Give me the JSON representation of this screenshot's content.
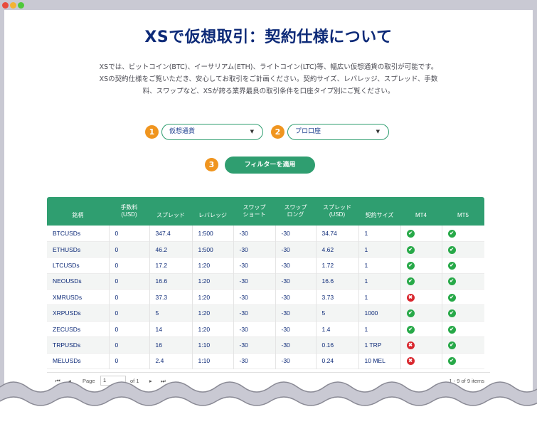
{
  "window": {
    "controls": [
      "close",
      "minimize",
      "maximize"
    ]
  },
  "page": {
    "title": "XSで仮想取引：契約仕様について",
    "intro_lines": [
      "XSでは、ビットコイン(BTC)、イーサリアム(ETH)、ライトコイン(LTC)等、幅広い仮想通貨の取引が可能です。",
      "XSの契約仕様をご覧いただき、安心してお取引をご計画ください。契約サイズ、レバレッジ、スプレッド、手数",
      "料、スワップなど、XSが誇る業界最良の取引条件を口座タイプ別にご覧ください。"
    ]
  },
  "filters": {
    "step1": "1",
    "step2": "2",
    "step3": "3",
    "instrument_select": "仮想通貨",
    "account_select": "プロ口座",
    "apply_label": "フィルターを適用"
  },
  "table": {
    "headers": {
      "symbol": "銘柄",
      "commission": [
        "手数料",
        "(USD)"
      ],
      "spread": "スプレッド",
      "leverage": "レバレッジ",
      "swap_short": [
        "スワップ",
        "ショート"
      ],
      "swap_long": [
        "スワップ",
        "ロング"
      ],
      "spread_usd": [
        "スプレッド",
        "(USD)"
      ],
      "contract_size": "契約サイズ",
      "mt4": "MT4",
      "mt5": "MT5"
    },
    "rows": [
      {
        "symbol": "BTCUSDs",
        "commission": "0",
        "spread": "347.4",
        "leverage": "1:500",
        "swap_short": "-30",
        "swap_long": "-30",
        "spread_usd": "34.74",
        "contract_size": "1",
        "mt4": true,
        "mt5": true
      },
      {
        "symbol": "ETHUSDs",
        "commission": "0",
        "spread": "46.2",
        "leverage": "1:500",
        "swap_short": "-30",
        "swap_long": "-30",
        "spread_usd": "4.62",
        "contract_size": "1",
        "mt4": true,
        "mt5": true
      },
      {
        "symbol": "LTCUSDs",
        "commission": "0",
        "spread": "17.2",
        "leverage": "1:20",
        "swap_short": "-30",
        "swap_long": "-30",
        "spread_usd": "1.72",
        "contract_size": "1",
        "mt4": true,
        "mt5": true
      },
      {
        "symbol": "NEOUSDs",
        "commission": "0",
        "spread": "16.6",
        "leverage": "1:20",
        "swap_short": "-30",
        "swap_long": "-30",
        "spread_usd": "16.6",
        "contract_size": "1",
        "mt4": true,
        "mt5": true
      },
      {
        "symbol": "XMRUSDs",
        "commission": "0",
        "spread": "37.3",
        "leverage": "1:20",
        "swap_short": "-30",
        "swap_long": "-30",
        "spread_usd": "3.73",
        "contract_size": "1",
        "mt4": false,
        "mt5": true
      },
      {
        "symbol": "XRPUSDs",
        "commission": "0",
        "spread": "5",
        "leverage": "1:20",
        "swap_short": "-30",
        "swap_long": "-30",
        "spread_usd": "5",
        "contract_size": "1000",
        "mt4": true,
        "mt5": true
      },
      {
        "symbol": "ZECUSDs",
        "commission": "0",
        "spread": "14",
        "leverage": "1:20",
        "swap_short": "-30",
        "swap_long": "-30",
        "spread_usd": "1.4",
        "contract_size": "1",
        "mt4": true,
        "mt5": true
      },
      {
        "symbol": "TRPUSDs",
        "commission": "0",
        "spread": "16",
        "leverage": "1:10",
        "swap_short": "-30",
        "swap_long": "-30",
        "spread_usd": "0.16",
        "contract_size": "1 TRP",
        "mt4": false,
        "mt5": true
      },
      {
        "symbol": "MELUSDs",
        "commission": "0",
        "spread": "2.4",
        "leverage": "1:10",
        "swap_short": "-30",
        "swap_long": "-30",
        "spread_usd": "0.24",
        "contract_size": "10 MEL",
        "mt4": false,
        "mt5": true
      }
    ]
  },
  "pager": {
    "first": "⏮",
    "prev": "◂",
    "page_label": "Page",
    "page_value": "1",
    "of_label": "of 1",
    "next": "▸",
    "last": "⏭",
    "summary": "1 - 9 of 9 items"
  },
  "colors": {
    "title": "#0d2a78",
    "accent": "#2f9e70",
    "badge": "#f0951f",
    "ok": "#27a948",
    "ng": "#d9282f"
  }
}
